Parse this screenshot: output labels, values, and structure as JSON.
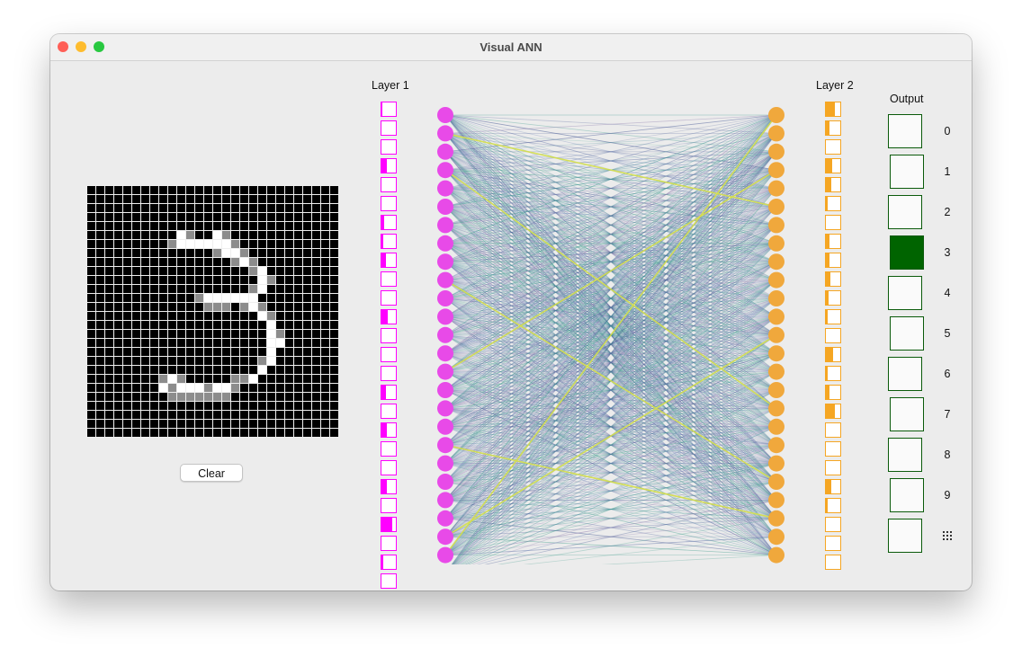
{
  "window": {
    "title": "Visual ANN"
  },
  "labels": {
    "layer1": "Layer 1",
    "layer2": "Layer 2",
    "output": "Output"
  },
  "clear_button": {
    "label": "Clear"
  },
  "colors": {
    "layer1": "#ff00ff",
    "layer2": "#f5a623",
    "output_active": "#006400"
  },
  "drawing_grid": {
    "rows": 28,
    "cols": 28,
    "strokes": [
      [
        5,
        10,
        1
      ],
      [
        5,
        11,
        0.5
      ],
      [
        5,
        14,
        1
      ],
      [
        5,
        15,
        0.5
      ],
      [
        6,
        9,
        0.5
      ],
      [
        6,
        10,
        1
      ],
      [
        6,
        11,
        1
      ],
      [
        6,
        12,
        1
      ],
      [
        6,
        13,
        1
      ],
      [
        6,
        14,
        1
      ],
      [
        6,
        15,
        1
      ],
      [
        6,
        16,
        0.5
      ],
      [
        7,
        14,
        0.5
      ],
      [
        7,
        15,
        1
      ],
      [
        7,
        16,
        1
      ],
      [
        7,
        17,
        0.5
      ],
      [
        8,
        16,
        0.5
      ],
      [
        8,
        17,
        1
      ],
      [
        8,
        18,
        0.5
      ],
      [
        9,
        18,
        0.5
      ],
      [
        9,
        19,
        1
      ],
      [
        10,
        19,
        1
      ],
      [
        10,
        20,
        0.5
      ],
      [
        11,
        18,
        0.5
      ],
      [
        11,
        19,
        1
      ],
      [
        12,
        12,
        0.5
      ],
      [
        12,
        13,
        1
      ],
      [
        12,
        14,
        1
      ],
      [
        12,
        15,
        1
      ],
      [
        12,
        16,
        1
      ],
      [
        12,
        17,
        1
      ],
      [
        12,
        18,
        1
      ],
      [
        13,
        13,
        0.5
      ],
      [
        13,
        14,
        0.5
      ],
      [
        13,
        15,
        0.5
      ],
      [
        13,
        17,
        0.5
      ],
      [
        13,
        18,
        1
      ],
      [
        13,
        19,
        0.5
      ],
      [
        14,
        19,
        1
      ],
      [
        14,
        20,
        0.5
      ],
      [
        15,
        20,
        1
      ],
      [
        16,
        20,
        1
      ],
      [
        16,
        21,
        0.5
      ],
      [
        17,
        20,
        1
      ],
      [
        17,
        21,
        1
      ],
      [
        18,
        20,
        1
      ],
      [
        19,
        19,
        0.5
      ],
      [
        19,
        20,
        1
      ],
      [
        20,
        19,
        1
      ],
      [
        21,
        8,
        0.5
      ],
      [
        21,
        9,
        1
      ],
      [
        21,
        10,
        0.5
      ],
      [
        21,
        16,
        0.5
      ],
      [
        21,
        17,
        0.5
      ],
      [
        21,
        18,
        1
      ],
      [
        22,
        8,
        1
      ],
      [
        22,
        9,
        0.5
      ],
      [
        22,
        10,
        1
      ],
      [
        22,
        11,
        1
      ],
      [
        22,
        12,
        1
      ],
      [
        22,
        13,
        0.5
      ],
      [
        22,
        14,
        1
      ],
      [
        22,
        15,
        1
      ],
      [
        22,
        16,
        0.5
      ],
      [
        23,
        9,
        0.5
      ],
      [
        23,
        10,
        0.5
      ],
      [
        23,
        11,
        0.5
      ],
      [
        23,
        12,
        0.5
      ],
      [
        23,
        13,
        0.5
      ],
      [
        23,
        14,
        0.5
      ],
      [
        23,
        15,
        0.5
      ]
    ]
  },
  "layer1_activations": [
    0.05,
    0,
    0,
    0.4,
    0,
    0,
    0.2,
    0.1,
    0.3,
    0,
    0,
    0.45,
    0,
    0,
    0,
    0.3,
    0,
    0.35,
    0,
    0,
    0.4,
    0,
    0.75,
    0,
    0.15,
    0
  ],
  "layer2_activations": [
    0.6,
    0.25,
    0,
    0.45,
    0.4,
    0.15,
    0,
    0.25,
    0.25,
    0.3,
    0.2,
    0.15,
    0,
    0.5,
    0.1,
    0.25,
    0.6,
    0,
    0,
    0,
    0.35,
    0.1,
    0,
    0,
    0
  ],
  "output": {
    "items": [
      {
        "label": "0",
        "active": false
      },
      {
        "label": "1",
        "active": false
      },
      {
        "label": "2",
        "active": false
      },
      {
        "label": "3",
        "active": true
      },
      {
        "label": "4",
        "active": false
      },
      {
        "label": "5",
        "active": false
      },
      {
        "label": "6",
        "active": false
      },
      {
        "label": "7",
        "active": false
      },
      {
        "label": "8",
        "active": false
      },
      {
        "label": "9",
        "active": false
      },
      {
        "label": "",
        "active": false,
        "icon": "dots-grid-icon"
      }
    ]
  }
}
